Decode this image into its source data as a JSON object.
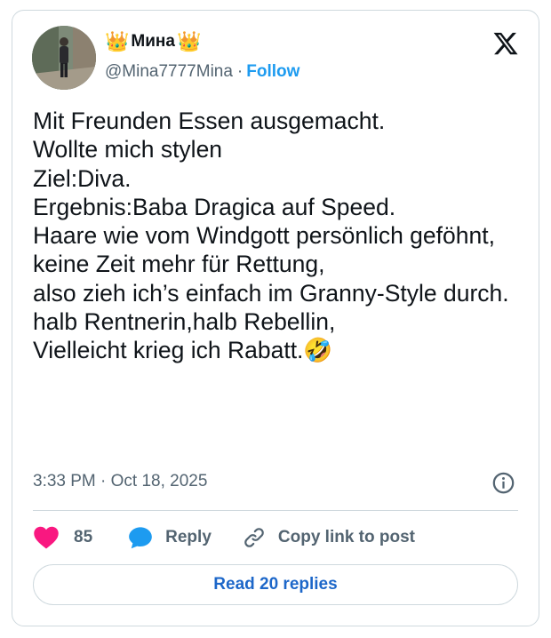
{
  "author": {
    "display_name": "Мина",
    "crown_left": "👑",
    "crown_right": "👑",
    "handle": "@Mina7777Mina",
    "separator": "·",
    "follow_label": "Follow"
  },
  "tweet": {
    "text": "Mit Freunden Essen ausgemacht.\nWollte mich stylen\nZiel:Diva.\nErgebnis:Baba Dragica auf Speed.\nHaare wie vom Windgott persönlich geföhnt,\nkeine Zeit mehr für Rettung,\nalso zieh ich’s einfach im Granny-Style durch.\nhalb Rentnerin,halb Rebellin,\nVielleicht krieg ich Rabatt.🤣",
    "timestamp": "3:33 PM · Oct 18, 2025"
  },
  "actions": {
    "like_count": "85",
    "reply_label": "Reply",
    "copy_label": "Copy link to post"
  },
  "footer": {
    "read_replies_label": "Read 20 replies"
  },
  "colors": {
    "accent": "#1d9bf0",
    "read_replies_text": "#1d67c9",
    "like": "#f91880",
    "reply_bubble": "#1d9bf0",
    "muted_text": "#536471",
    "border": "#cfd9de"
  },
  "icons": [
    "x-logo-icon",
    "info-icon",
    "heart-icon",
    "speech-bubble-icon",
    "link-icon",
    "crown-emoji"
  ]
}
